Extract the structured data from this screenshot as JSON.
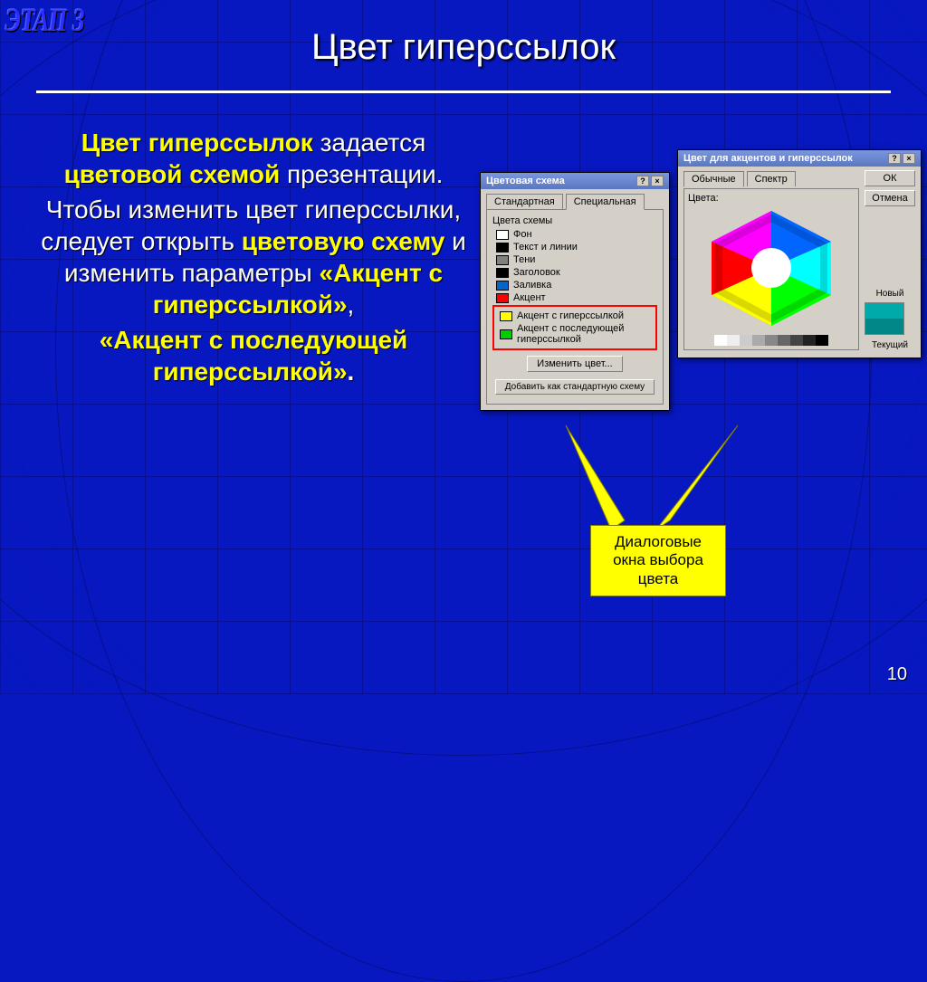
{
  "stage_label": "ЭТАП 3",
  "title": "Цвет гиперссылок",
  "body": {
    "seg1_hl": "Цвет гиперссылок",
    "seg2": " задается ",
    "seg3_hl": "цветовой схемой",
    "seg4": " презентации.",
    "seg5": "Чтобы изменить цвет гиперссылки, следует открыть ",
    "seg6_hl": "цветовую схему",
    "seg7": " и изменить параметры ",
    "seg8_hl": "«Акцент с гиперссылкой»",
    "seg8_comma": ",",
    "seg9_hl": "«Акцент с последующей гиперссылкой»",
    "seg9_dot": "."
  },
  "dlg1": {
    "title": "Цветовая схема",
    "tabs": {
      "standard": "Стандартная",
      "custom": "Специальная"
    },
    "group_label": "Цвета схемы",
    "items": [
      {
        "label": "Фон",
        "color": "#ffffff"
      },
      {
        "label": "Текст и линии",
        "color": "#000000"
      },
      {
        "label": "Тени",
        "color": "#808080"
      },
      {
        "label": "Заголовок",
        "color": "#000000"
      },
      {
        "label": "Заливка",
        "color": "#0066cc"
      },
      {
        "label": "Акцент",
        "color": "#ff0000"
      }
    ],
    "hl_items": [
      {
        "label": "Акцент с гиперссылкой",
        "color": "#ffff00"
      },
      {
        "label": "Акцент с последующей гиперссылкой",
        "color": "#00cc00"
      }
    ],
    "change_color_btn": "Изменить цвет...",
    "add_scheme_btn": "Добавить как стандартную схему"
  },
  "dlg2": {
    "title": "Цвет для акцентов и гиперссылок",
    "tabs": {
      "usual": "Обычные",
      "spectrum": "Спектр"
    },
    "colors_label": "Цвета:",
    "ok": "ОК",
    "cancel": "Отмена",
    "new_label": "Новый",
    "current_label": "Текущий"
  },
  "callout": "Диалоговые окна выбора цвета",
  "page_number": "10"
}
